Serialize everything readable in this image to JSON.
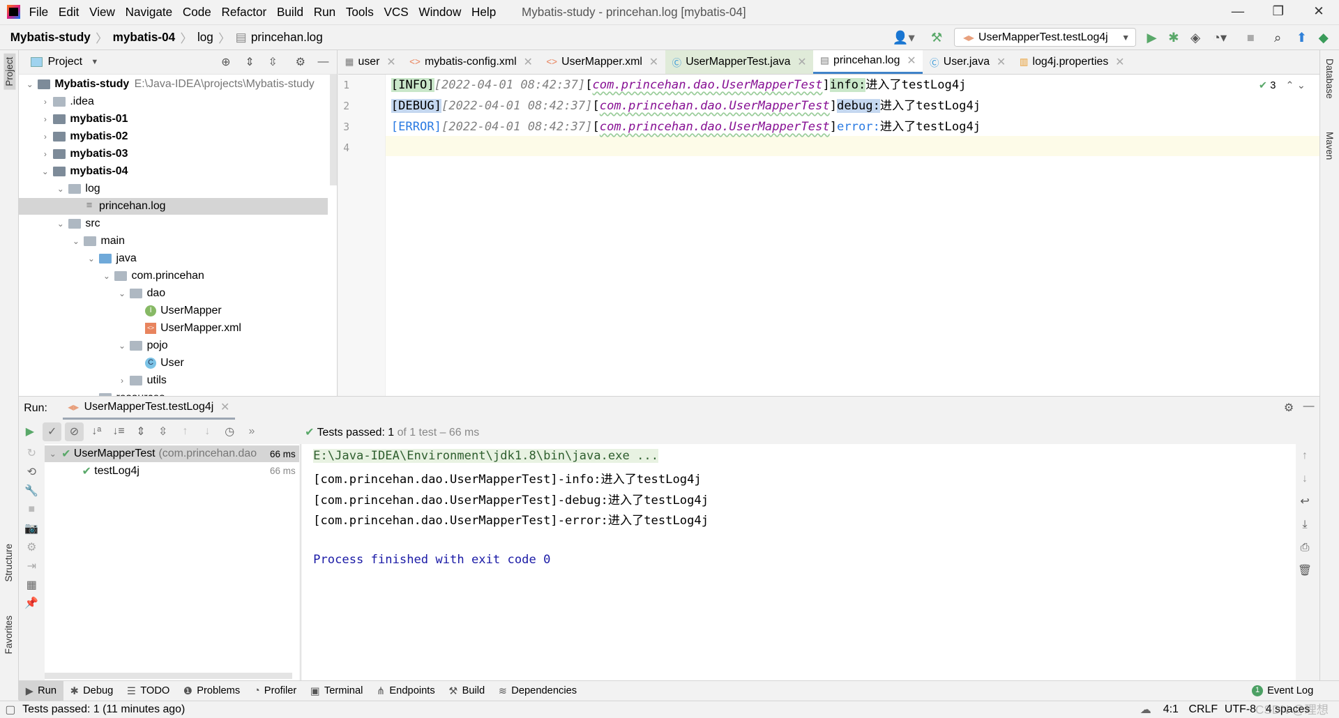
{
  "menu": [
    "File",
    "Edit",
    "View",
    "Navigate",
    "Code",
    "Refactor",
    "Build",
    "Run",
    "Tools",
    "VCS",
    "Window",
    "Help"
  ],
  "window_title": "Mybatis-study - princehan.log [mybatis-04]",
  "breadcrumb": [
    "Mybatis-study",
    "mybatis-04",
    "log",
    "princehan.log"
  ],
  "run_config": "UserMapperTest.testLog4j",
  "left_stripe": {
    "project": "Project",
    "structure": "Structure",
    "favorites": "Favorites"
  },
  "right_stripe": {
    "database": "Database",
    "maven": "Maven"
  },
  "project": {
    "title": "Project",
    "tree": [
      {
        "label": "Mybatis-study",
        "hint": "E:\\Java-IDEA\\projects\\Mybatis-study",
        "depth": 0,
        "open": true,
        "bold": true,
        "icon": "module"
      },
      {
        "label": ".idea",
        "depth": 1,
        "open": false,
        "icon": "folder"
      },
      {
        "label": "mybatis-01",
        "depth": 1,
        "open": false,
        "bold": true,
        "icon": "module"
      },
      {
        "label": "mybatis-02",
        "depth": 1,
        "open": false,
        "bold": true,
        "icon": "module"
      },
      {
        "label": "mybatis-03",
        "depth": 1,
        "open": false,
        "bold": true,
        "icon": "module"
      },
      {
        "label": "mybatis-04",
        "depth": 1,
        "open": true,
        "bold": true,
        "icon": "module"
      },
      {
        "label": "log",
        "depth": 2,
        "open": true,
        "icon": "folder"
      },
      {
        "label": "princehan.log",
        "depth": 3,
        "icon": "file",
        "selected": true
      },
      {
        "label": "src",
        "depth": 2,
        "open": true,
        "icon": "folder"
      },
      {
        "label": "main",
        "depth": 3,
        "open": true,
        "icon": "folder"
      },
      {
        "label": "java",
        "depth": 4,
        "open": true,
        "icon": "source-folder"
      },
      {
        "label": "com.princehan",
        "depth": 5,
        "open": true,
        "icon": "package"
      },
      {
        "label": "dao",
        "depth": 6,
        "open": true,
        "icon": "package"
      },
      {
        "label": "UserMapper",
        "depth": 7,
        "icon": "interface"
      },
      {
        "label": "UserMapper.xml",
        "depth": 7,
        "icon": "xml"
      },
      {
        "label": "pojo",
        "depth": 6,
        "open": true,
        "icon": "package"
      },
      {
        "label": "User",
        "depth": 7,
        "icon": "class"
      },
      {
        "label": "utils",
        "depth": 6,
        "open": false,
        "icon": "package"
      },
      {
        "label": "resources",
        "depth": 4,
        "open": true,
        "icon": "folder"
      }
    ]
  },
  "tabs": [
    {
      "label": "user",
      "icon": "table"
    },
    {
      "label": "mybatis-config.xml",
      "icon": "xml"
    },
    {
      "label": "UserMapper.xml",
      "icon": "xml"
    },
    {
      "label": "UserMapperTest.java",
      "icon": "class",
      "green": true
    },
    {
      "label": "princehan.log",
      "icon": "file",
      "active": true
    },
    {
      "label": "User.java",
      "icon": "class"
    },
    {
      "label": "log4j.properties",
      "icon": "properties"
    }
  ],
  "editor": {
    "inspection_count": "3",
    "lines": [
      {
        "n": "1",
        "level": "[INFO]",
        "date": "[2022-04-01 08:42:37]",
        "cls": "com.princehan.dao.UserMapperTest",
        "lb": "[",
        "rb": "]",
        "kind": "info:",
        "msg": "进入了testLog4j"
      },
      {
        "n": "2",
        "level": "[DEBUG]",
        "date": "[2022-04-01 08:42:37]",
        "cls": "com.princehan.dao.UserMapperTest",
        "lb": "[",
        "rb": "]",
        "kind": "debug:",
        "msg": "进入了testLog4j"
      },
      {
        "n": "3",
        "level": "[ERROR]",
        "date": "[2022-04-01 08:42:37]",
        "cls": "com.princehan.dao.UserMapperTest",
        "lb": "[",
        "rb": "]",
        "kind": "error:",
        "msg": "进入了testLog4j"
      },
      {
        "n": "4"
      }
    ]
  },
  "run": {
    "label": "Run:",
    "tab": "UserMapperTest.testLog4j",
    "summary_bold": "Tests passed:",
    "summary_count": "1",
    "summary_rest": "of 1 test – 66 ms",
    "tests": [
      {
        "name": "UserMapperTest",
        "hint": "(com.princehan.dao",
        "time": "66 ms"
      },
      {
        "name": "testLog4j",
        "time": "66 ms"
      }
    ],
    "console": [
      "E:\\Java-IDEA\\Environment\\jdk1.8\\bin\\java.exe ...",
      "[com.princehan.dao.UserMapperTest]-info:进入了testLog4j",
      "[com.princehan.dao.UserMapperTest]-debug:进入了testLog4j",
      "[com.princehan.dao.UserMapperTest]-error:进入了testLog4j",
      "",
      "Process finished with exit code 0"
    ]
  },
  "toolwindows": [
    "Run",
    "Debug",
    "TODO",
    "Problems",
    "Profiler",
    "Terminal",
    "Endpoints",
    "Build",
    "Dependencies"
  ],
  "event_log": {
    "label": "Event Log",
    "count": "1"
  },
  "status": {
    "message": "Tests passed: 1 (11 minutes ago)",
    "position": "4:1",
    "line_sep": "CRLF",
    "encoding": "UTF-8",
    "indent": "4 spaces",
    "watermark": "CSDN @理想"
  },
  "colors": {
    "accent": "#4083c9",
    "pass": "#59a869",
    "info_bg": "#c9e7c9",
    "debug_bg": "#c5d8f0",
    "error_fg": "#2a7ae2",
    "pkg": "#871094"
  }
}
